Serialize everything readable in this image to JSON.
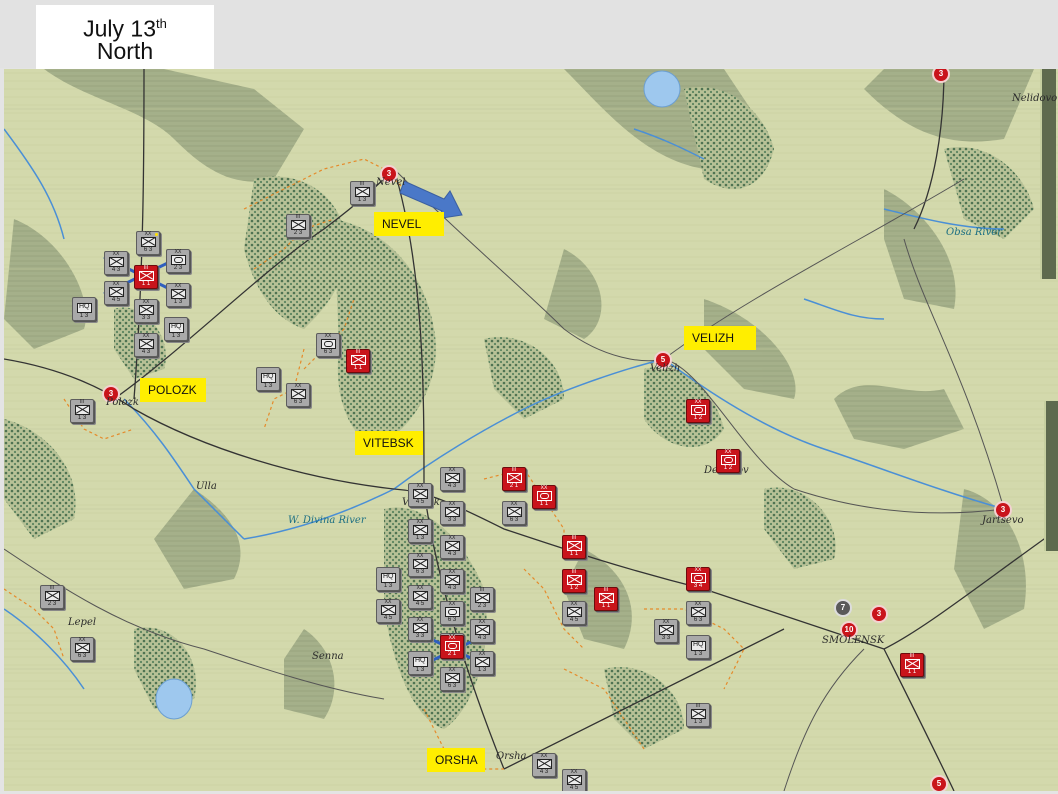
{
  "header": {
    "date_main": "July 13",
    "date_suffix": "th",
    "region": "North"
  },
  "city_labels": {
    "nevel": "NEVEL",
    "velizh": "VELIZH",
    "polozk": "POLOZK",
    "vitebsk": "VITEBSK",
    "orsha": "ORSHA"
  },
  "map_names": {
    "nevel": "Nevel",
    "velizh": "Velizh",
    "polozk": "Polozk",
    "vitebsk": "Vitebsk",
    "orsha": "Orsha",
    "demidov": "Demidov",
    "smolensk": "SMOLENSK",
    "yartsevo": "Jartsevo",
    "ulla": "Ulla",
    "lepel": "Lepel",
    "senna": "Senna",
    "nelidovo": "Nelidovo"
  },
  "rivers": {
    "divina": "W. Divina River",
    "obsa": "Obsa River"
  },
  "city_values": {
    "nevel": "3",
    "velizh": "5",
    "polozk": "3",
    "smolensk": "10",
    "smolensk_east": "3",
    "smolensk_turn": "7",
    "yartsevo": "3",
    "top_right": "3",
    "bottom_right": "5"
  },
  "colors": {
    "german_counter": "#a9a9a9",
    "soviet_counter": "#c9141b",
    "label_highlight": "#ffee00",
    "map_terrain": "#d6dcb0",
    "river": "#4a8fd6",
    "front_arrow": "#4a78c8"
  },
  "german_units": [
    {
      "sym": "inf",
      "sz": "III",
      "val": "1 3"
    },
    {
      "sym": "inf",
      "sz": "III",
      "val": "2 3"
    },
    {
      "sym": "hq",
      "sz": "",
      "val": "1 3"
    },
    {
      "sym": "inf",
      "sz": "XX",
      "val": "6 3"
    },
    {
      "sym": "arm",
      "sz": "XX",
      "val": "2 3"
    },
    {
      "sym": "inf",
      "sz": "XX",
      "val": "4 3"
    },
    {
      "sym": "inf",
      "sz": "XX",
      "val": "4 5"
    },
    {
      "sym": "inf",
      "sz": "XX",
      "val": "3 3"
    },
    {
      "sym": "hq",
      "sz": "",
      "val": "1 3"
    },
    {
      "sym": "inf",
      "sz": "XX",
      "val": "1 3"
    },
    {
      "sym": "inf",
      "sz": "XX",
      "val": "4 3"
    },
    {
      "sym": "inf",
      "sz": "XX",
      "val": "6 3"
    },
    {
      "sym": "arm",
      "sz": "XX",
      "val": "6 3"
    },
    {
      "sym": "hq",
      "sz": "",
      "val": "1 3"
    },
    {
      "sym": "inf",
      "sz": "XX",
      "val": "4 5"
    }
  ],
  "soviet_units": [
    {
      "sym": "inf",
      "sz": "III",
      "val": "1 1"
    },
    {
      "sym": "inf",
      "sz": "III",
      "val": "1 1"
    },
    {
      "sym": "arm",
      "sz": "XX",
      "val": "1 2"
    },
    {
      "sym": "arm",
      "sz": "XX",
      "val": "1 2"
    },
    {
      "sym": "inf",
      "sz": "III",
      "val": "2 1"
    },
    {
      "sym": "arm",
      "sz": "XX",
      "val": "1 1"
    },
    {
      "sym": "inf",
      "sz": "III",
      "val": "1 1"
    },
    {
      "sym": "inf",
      "sz": "III",
      "val": "1 2"
    },
    {
      "sym": "arm",
      "sz": "XX",
      "val": "3 4"
    },
    {
      "sym": "inf",
      "sz": "III",
      "val": "1 1"
    },
    {
      "sym": "arm",
      "sz": "XX",
      "val": "2 1"
    }
  ]
}
